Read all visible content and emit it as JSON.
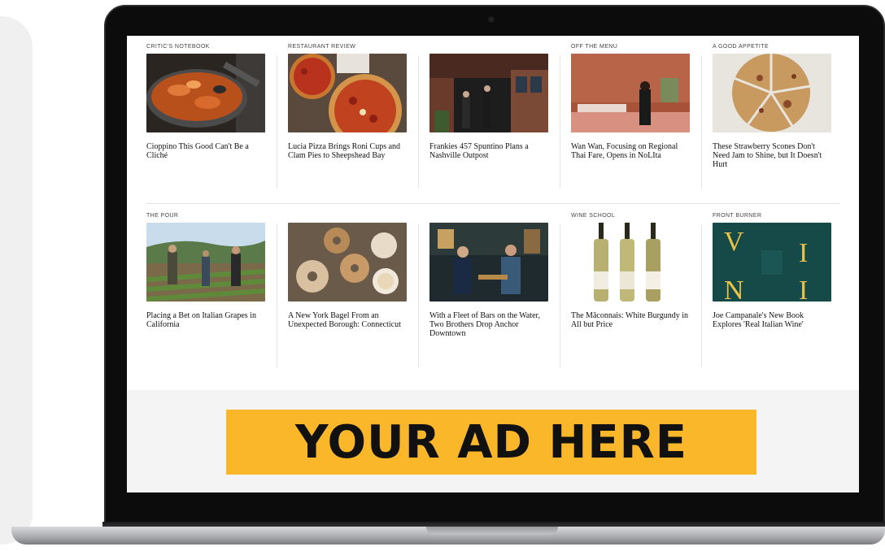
{
  "colors": {
    "ad_background": "#fbb72a",
    "ad_text": "#111111",
    "bezel": "#0c0c0d"
  },
  "articles_row_1": [
    {
      "kicker": "CRITIC'S NOTEBOOK",
      "headline": "Cioppino This Good Can't Be a Cliché",
      "image": "cioppino-photo"
    },
    {
      "kicker": "RESTAURANT REVIEW",
      "headline": "Lucia Pizza Brings Roni Cups and Clam Pies to Sheepshead Bay",
      "image": "pizza-photo"
    },
    {
      "kicker": "",
      "headline": "Frankies 457 Spuntino Plans a Nashville Outpost",
      "image": "storefront-photo"
    },
    {
      "kicker": "OFF THE MENU",
      "headline": "Wan Wan, Focusing on Regional Thai Fare, Opens in NoLIta",
      "image": "restaurant-interior-photo"
    },
    {
      "kicker": "A GOOD APPETITE",
      "headline": "These Strawberry Scones Don't Need Jam to Shine, but It Doesn't Hurt",
      "image": "scones-photo"
    }
  ],
  "articles_row_2": [
    {
      "kicker": "THE POUR",
      "headline": "Placing a Bet on Italian Grapes in California",
      "image": "vineyard-photo"
    },
    {
      "kicker": "",
      "headline": "A New York Bagel From an Unexpected Borough: Connecticut",
      "image": "bagels-photo"
    },
    {
      "kicker": "",
      "headline": "With a Fleet of Bars on the Water, Two Brothers Drop Anchor Downtown",
      "image": "bar-photo"
    },
    {
      "kicker": "WINE SCHOOL",
      "headline": "The Mâconnais: White Burgundy in All but Price",
      "image": "wine-bottles-photo"
    },
    {
      "kicker": "FRONT BURNER",
      "headline": "Joe Campanale's New Book Explores 'Real Italian Wine'",
      "image": "book-cover-photo"
    }
  ],
  "ad": {
    "text": "YOUR AD HERE"
  },
  "book_cover": {
    "letters": [
      "V",
      "I",
      "N",
      "I"
    ]
  }
}
